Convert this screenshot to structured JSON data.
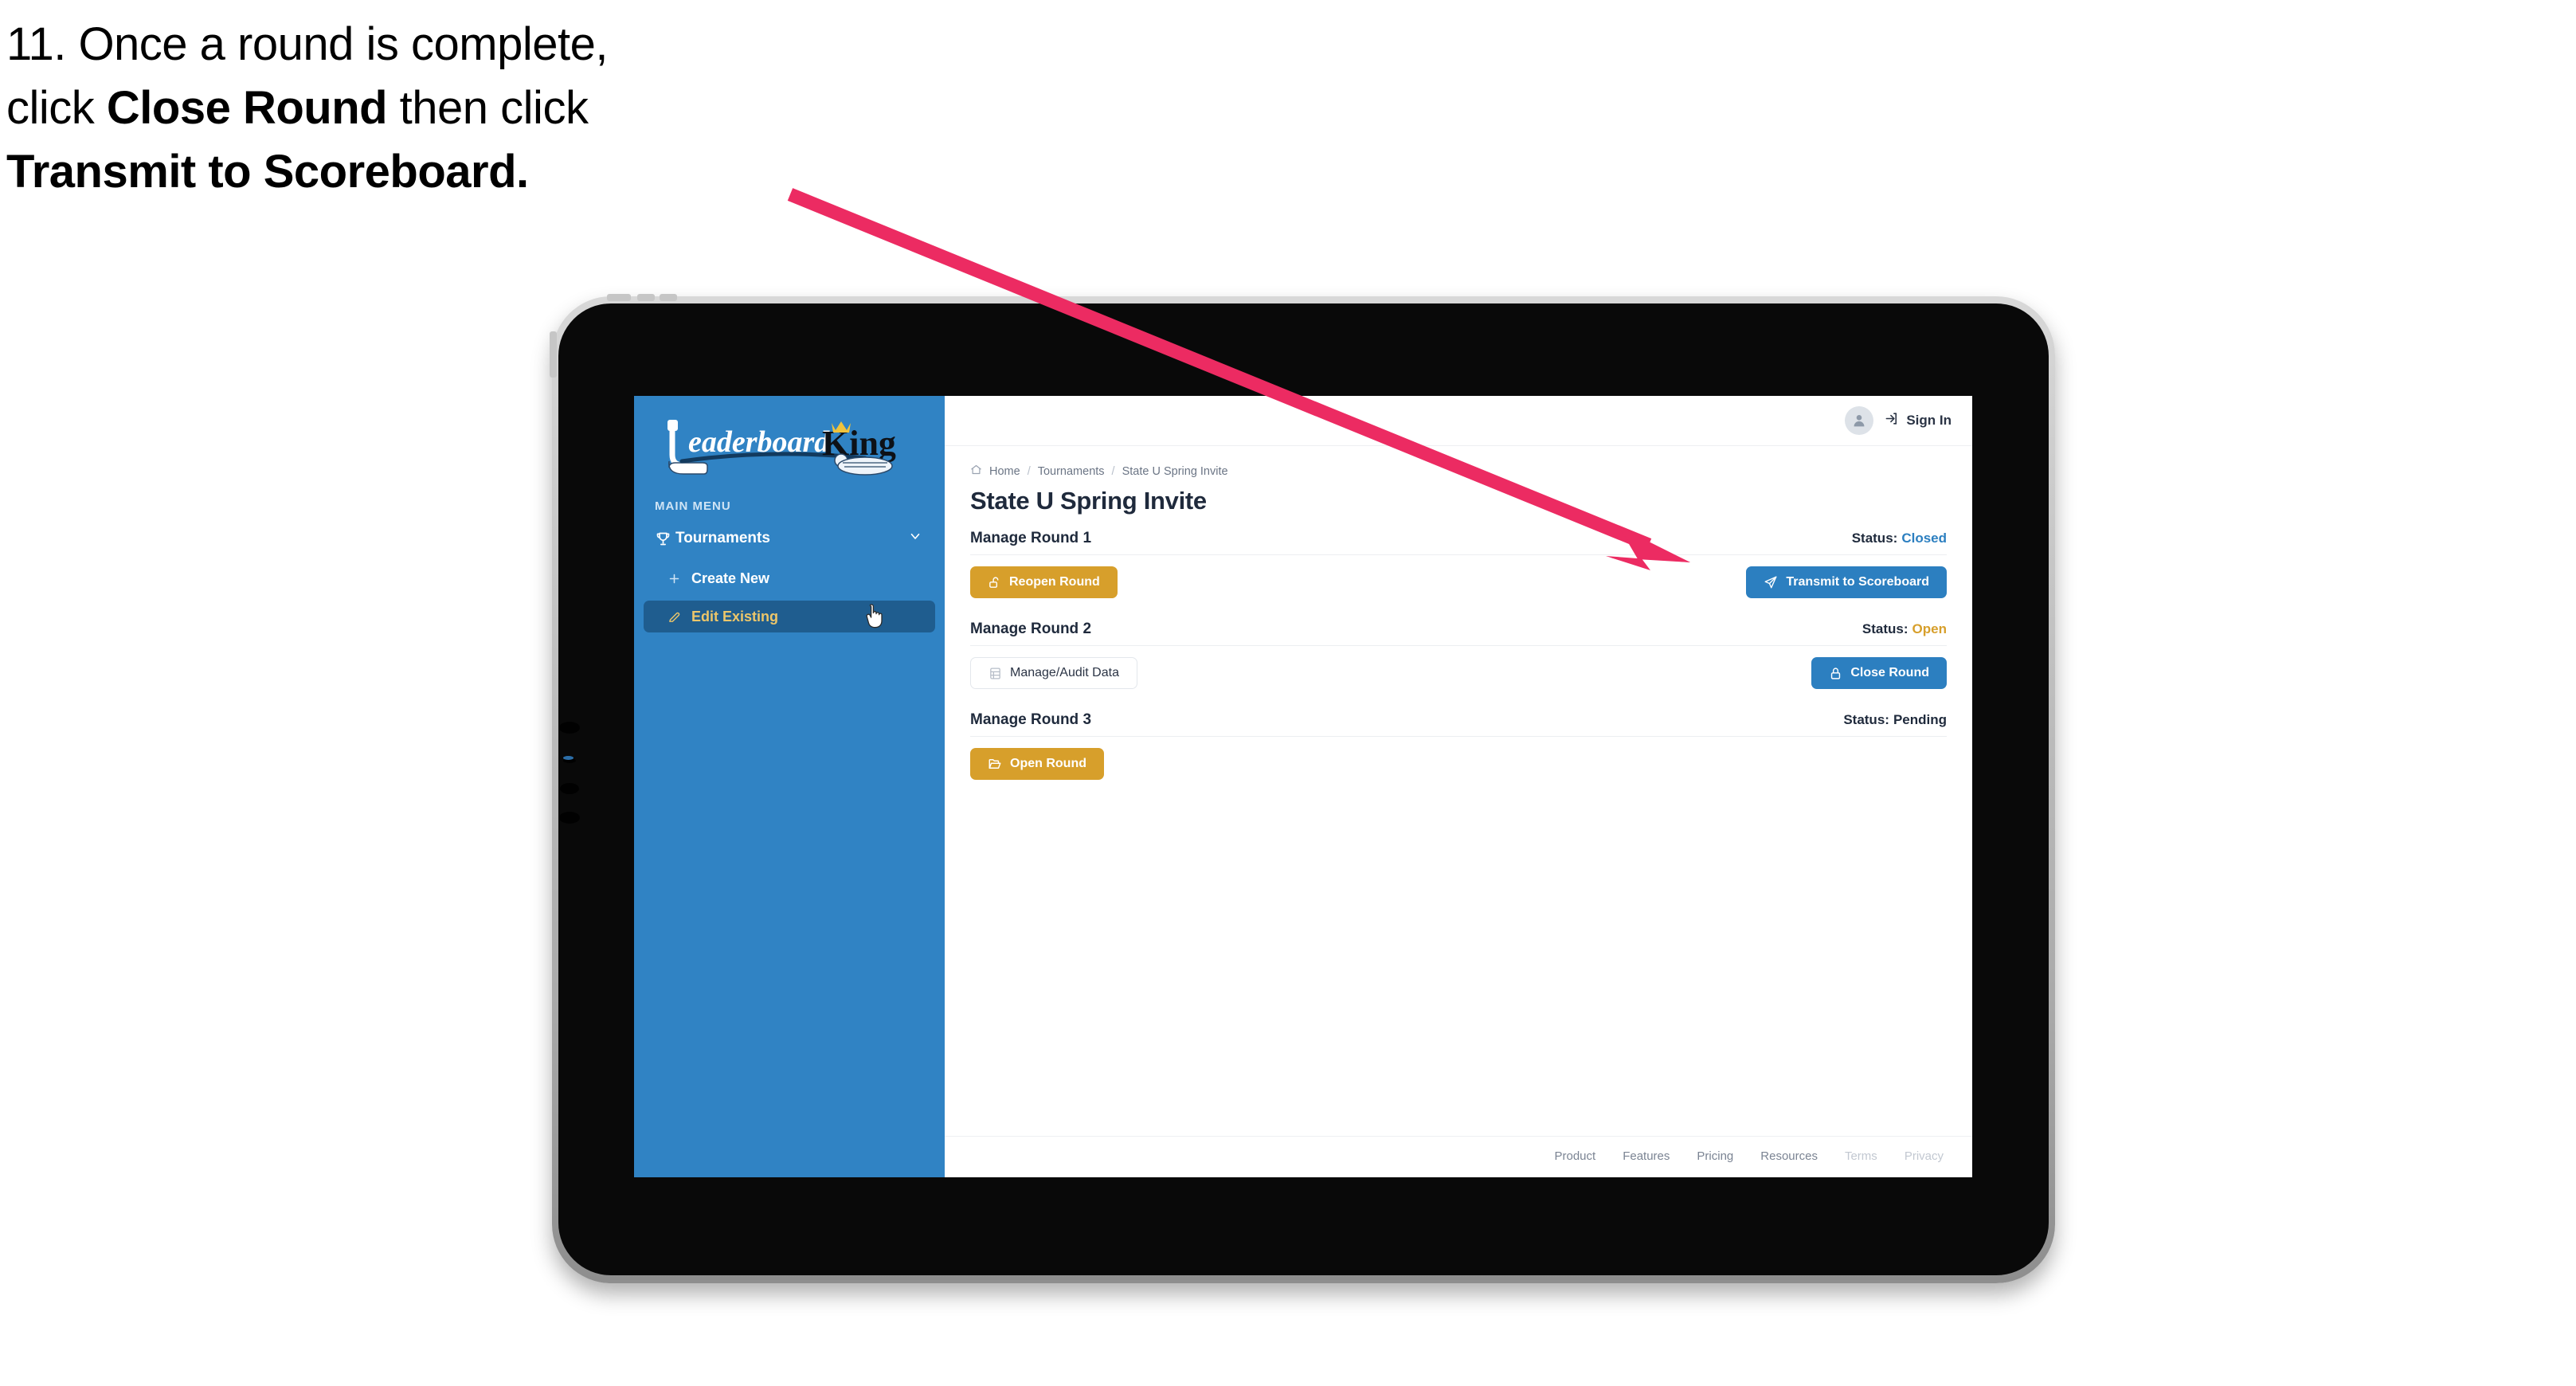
{
  "caption": {
    "line1_prefix": "11. Once a round is complete,",
    "line2_pre": "click ",
    "line2_bold": "Close Round",
    "line2_post": " then click",
    "line3_bold": "Transmit to Scoreboard."
  },
  "annotation": {
    "arrow_color": "#ec2b62"
  },
  "sidebar": {
    "logo_primary": "Leaderboard",
    "logo_secondary": "King",
    "menu_label": "MAIN MENU",
    "items": [
      {
        "label": "Tournaments",
        "icon": "trophy-icon",
        "chevron": "chevron-down-icon",
        "active": false
      },
      {
        "label": "Create New",
        "icon": "plus-icon",
        "active": false
      },
      {
        "label": "Edit Existing",
        "icon": "edit-pencil-icon",
        "active": true
      }
    ],
    "background": "#3083c4",
    "active_background": "#1f5d8f",
    "active_text": "#ecc66a"
  },
  "topbar": {
    "avatar_icon": "user-avatar-icon",
    "signin_icon": "login-arrow-icon",
    "signin_label": "Sign In"
  },
  "breadcrumb": {
    "home_icon": "home-icon",
    "items": [
      "Home",
      "Tournaments",
      "State U Spring Invite"
    ],
    "separator": "/"
  },
  "page": {
    "title": "State U Spring Invite"
  },
  "rounds": [
    {
      "title": "Manage Round 1",
      "status_label": "Status:",
      "status_value": "Closed",
      "status_class": "closed",
      "left_button": {
        "label": "Reopen Round",
        "icon": "unlock-icon",
        "style": "gold"
      },
      "right_button": {
        "label": "Transmit to Scoreboard",
        "icon": "send-plane-icon",
        "style": "blue"
      }
    },
    {
      "title": "Manage Round 2",
      "status_label": "Status:",
      "status_value": "Open",
      "status_class": "open",
      "left_button": {
        "label": "Manage/Audit Data",
        "icon": "table-grid-icon",
        "style": "ghost"
      },
      "right_button": {
        "label": "Close Round",
        "icon": "lock-icon",
        "style": "blue"
      }
    },
    {
      "title": "Manage Round 3",
      "status_label": "Status:",
      "status_value": "Pending",
      "status_class": "pending",
      "left_button": {
        "label": "Open Round",
        "icon": "open-folder-icon",
        "style": "gold"
      },
      "right_button": null
    }
  ],
  "footer": {
    "links": [
      {
        "label": "Product",
        "dim": false
      },
      {
        "label": "Features",
        "dim": false
      },
      {
        "label": "Pricing",
        "dim": false
      },
      {
        "label": "Resources",
        "dim": false
      },
      {
        "label": "Terms",
        "dim": true
      },
      {
        "label": "Privacy",
        "dim": true
      }
    ]
  },
  "colors": {
    "brand_blue": "#2c7fc0",
    "sidebar_blue": "#3083c4",
    "gold": "#d79f2b",
    "ink": "#1f2a3c",
    "accent_pink": "#ec2b62"
  }
}
